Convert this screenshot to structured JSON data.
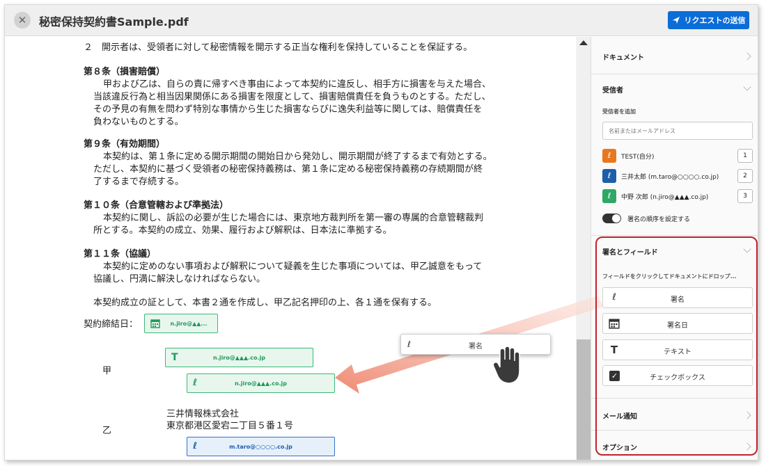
{
  "header": {
    "close_icon": "close-icon",
    "title": "秘密保持契約書Sample.pdf",
    "send_label": "リクエストの送信"
  },
  "document": {
    "lines": [
      {
        "text": "２　開示者は、受領者に対して秘密情報を開示する正当な権利を保持していることを保証する。",
        "bold": false
      },
      {
        "text": "第８条（損害賠償）",
        "bold": true
      },
      {
        "text": "甲および乙は、自らの責に帰すべき事由によって本契約に違反し、相手方に損害を与えた場合、",
        "bold": false
      },
      {
        "text": "当該違反行為と相当因果関係にある損害を限度として、損害賠償責任を負うものとする。ただし、",
        "bold": false
      },
      {
        "text": "その予見の有無を問わず特別な事情から生じた損害ならびに逸失利益等に関しては、賠償責任を",
        "bold": false
      },
      {
        "text": "負わないものとする。",
        "bold": false
      },
      {
        "text": "第９条（有効期間）",
        "bold": true
      },
      {
        "text": "本契約は、第１条に定める開示期間の開始日から発効し、開示期間が終了するまで有効とする。",
        "bold": false
      },
      {
        "text": "ただし、本契約に基づく受領者の秘密保持義務は、第１条に定める秘密保持義務の存続期間が終",
        "bold": false
      },
      {
        "text": "了するまで存続する。",
        "bold": false
      },
      {
        "text": "第１０条（合意管轄および準拠法）",
        "bold": true
      },
      {
        "text": "本契約に関し、訴訟の必要が生じた場合には、東京地方裁判所を第一審の専属的合意管轄裁判",
        "bold": false
      },
      {
        "text": "所とする。本契約の成立、効果、履行および解釈は、日本法に準拠する。",
        "bold": false
      },
      {
        "text": "第１１条（協議）",
        "bold": true
      },
      {
        "text": "本契約に定めのない事項および解釈について疑義を生じた事項については、甲乙誠意をもって",
        "bold": false
      },
      {
        "text": "協議し、円満に解決しなければならない。",
        "bold": false
      },
      {
        "text": "本契約成立の証として、本書２通を作成し、甲乙記名押印の上、各１通を保有する。",
        "bold": false
      }
    ],
    "date_label": "契約締結日：",
    "party_a": "甲",
    "party_b": "乙",
    "company_name": "三井情報株式会社",
    "company_address": "東京都港区愛宕二丁目５番１号",
    "fields": {
      "date_field_email": "n.jiro@▲▲...",
      "text_field_email": "n.jiro@▲▲▲.co.jp",
      "sig_field_a_email": "n.jiro@▲▲▲.co.jp",
      "sig_field_b_email": "m.taro@○○○○.co.jp"
    },
    "drag_ghost_label": "署名"
  },
  "sidebar": {
    "document_title": "ドキュメント",
    "recipients_title": "受信者",
    "add_recipient_label": "受信者を追加",
    "recipient_placeholder": "名前またはメールアドレス",
    "recipients": [
      {
        "name": "TEST(自分)",
        "order": "1",
        "color": "#e8781f"
      },
      {
        "name": "三井太郎 (m.taro@○○○○.co.jp)",
        "order": "2",
        "color": "#1f5ea8"
      },
      {
        "name": "中野 次郎 (n.jiro@▲▲▲.co.jp)",
        "order": "3",
        "color": "#2fa866"
      }
    ],
    "signing_order_label": "署名の順序を設定する",
    "fields_title": "署名とフィールド",
    "fields_hint": "フィールドをクリックしてドキュメントにドロップ...",
    "field_buttons": {
      "signature": "署名",
      "sign_date": "署名日",
      "text": "テキスト",
      "checkbox": "チェックボックス"
    },
    "email_notify_title": "メール通知",
    "options_title": "オプション"
  },
  "colors": {
    "accent": "#0b6dd8",
    "highlight_frame": "#c0222b",
    "field_green": "#3cb878",
    "field_blue": "#2e72c9",
    "arrow": "#f19a86"
  }
}
